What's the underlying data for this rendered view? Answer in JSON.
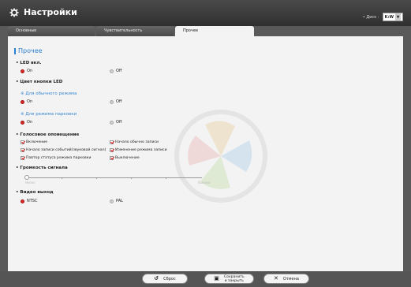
{
  "app": {
    "title": "Настройки"
  },
  "disk": {
    "label": "• Диск :",
    "value": "K:W"
  },
  "tabs": [
    {
      "label": "Основные",
      "active": false
    },
    {
      "label": "Чувствительность",
      "active": false
    },
    {
      "label": "Прочее",
      "active": true
    }
  ],
  "section": {
    "title": "Прочее"
  },
  "led": {
    "label": "• LED вкл.",
    "options": [
      "On",
      "Off"
    ],
    "selected": "On"
  },
  "led_color": {
    "label": "• Цвет кнопки LED",
    "normal": {
      "label": "※ Для обычного режима",
      "options": [
        "On",
        "Off"
      ],
      "selected": "On"
    },
    "parking": {
      "label": "※ Для режима парковки",
      "options": [
        "On",
        "Off"
      ],
      "selected": "On"
    }
  },
  "voice": {
    "label": "• Голосовое оповещение",
    "items": [
      {
        "label": "Включение",
        "checked": true
      },
      {
        "label": "Начало обычно записи",
        "checked": true
      },
      {
        "label": "Начало записи событий(звуковой сигнал)",
        "checked": true
      },
      {
        "label": "Изменение режима записи",
        "checked": true
      },
      {
        "label": "Повтор статуса режима парковки",
        "checked": true
      },
      {
        "label": "Выключение",
        "checked": true
      }
    ]
  },
  "volume": {
    "label": "• Громкость сигнала",
    "min_label": "Низко",
    "max_label": "Высоко",
    "level": 0
  },
  "video": {
    "label": "• Видео выход",
    "options": [
      "NTSC",
      "PAL"
    ],
    "selected": "NTSC"
  },
  "footer": {
    "reset": "Сброс",
    "save_line1": "Сохранить",
    "save_line2": "и закрыть",
    "cancel": "Отмена"
  },
  "colors": {
    "accent": "#2c7fd1",
    "radio_on": "#d62b2b",
    "titlebar": "#3a3a3a"
  }
}
